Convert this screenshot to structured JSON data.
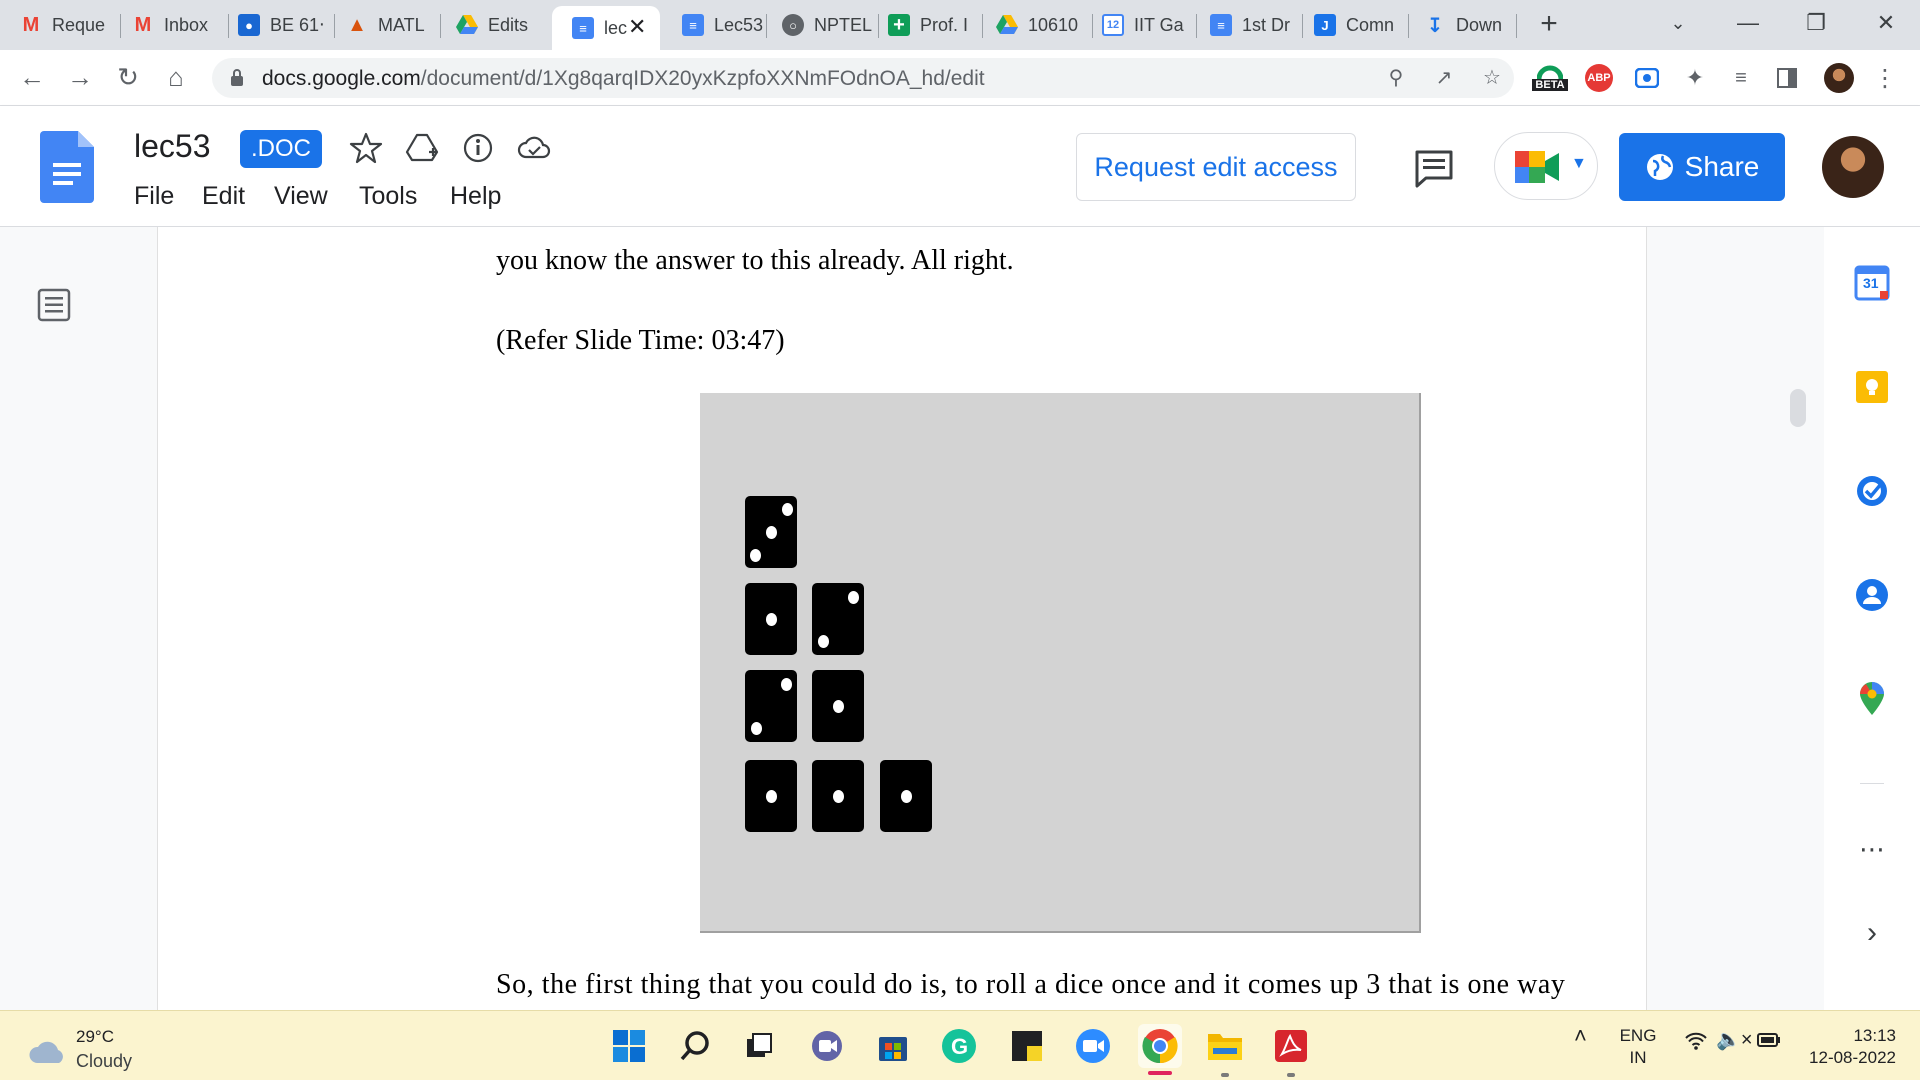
{
  "browser": {
    "tabs": [
      {
        "label": "Reque",
        "icon": "gmail-icon",
        "color": "#ea4335"
      },
      {
        "label": "Inbox",
        "icon": "gmail-icon",
        "color": "#ea4335"
      },
      {
        "label": "BE 61‧",
        "icon": "classroom-icon",
        "color": "#1e8e3e"
      },
      {
        "label": "MATL",
        "icon": "matlab-icon",
        "color": "#d9530d"
      },
      {
        "label": "Edits",
        "icon": "drive-icon",
        "color": "#fbbc04"
      },
      {
        "label": "lec",
        "icon": "docs-icon",
        "color": "#4285f4"
      },
      {
        "label": "Lec53",
        "icon": "docs-icon",
        "color": "#4285f4"
      },
      {
        "label": "NPTEL",
        "icon": "globe-icon",
        "color": "#5f6368"
      },
      {
        "label": "Prof. I",
        "icon": "sheets-plus-icon",
        "color": "#0f9d58"
      },
      {
        "label": "10610",
        "icon": "drive-icon",
        "color": "#fbbc04"
      },
      {
        "label": "IIT Ga",
        "icon": "calendar-icon",
        "color": "#4285f4"
      },
      {
        "label": "1st Dr",
        "icon": "docs-icon",
        "color": "#4285f4"
      },
      {
        "label": "Comn",
        "icon": "jamboard-icon",
        "color": "#1a73e8"
      },
      {
        "label": "Down",
        "icon": "download-icon",
        "color": "#1a73e8"
      }
    ],
    "url_host": "docs.google.com",
    "url_path": "/document/d/1Xg8qarqIDX20yxKzpfoXXNmFOdnOA_hd/edit",
    "beta_label": "BETA",
    "abp_label": "ABP"
  },
  "docs": {
    "title": "lec53",
    "badge": ".DOC",
    "menu": [
      "File",
      "Edit",
      "View",
      "Tools",
      "Help"
    ],
    "request_label": "Request edit access",
    "share_label": "Share"
  },
  "document": {
    "line1": "you know the answer to this already. All right.",
    "line2": "(Refer Slide Time: 03:47)",
    "line3": "So, the first thing that you could do is, to roll a dice once and it comes up 3 that is one way",
    "slide_dice_rows": [
      {
        "dice": [
          3
        ]
      },
      {
        "dice": [
          1,
          2
        ]
      },
      {
        "dice": [
          2,
          1
        ]
      },
      {
        "dice": [
          1,
          1,
          1
        ]
      }
    ]
  },
  "sidepanel": {
    "calendar_day": "31"
  },
  "taskbar": {
    "temperature": "29°C",
    "condition": "Cloudy",
    "lang1": "ENG",
    "lang2": "IN",
    "time": "13:13",
    "date": "12-08-2022"
  }
}
